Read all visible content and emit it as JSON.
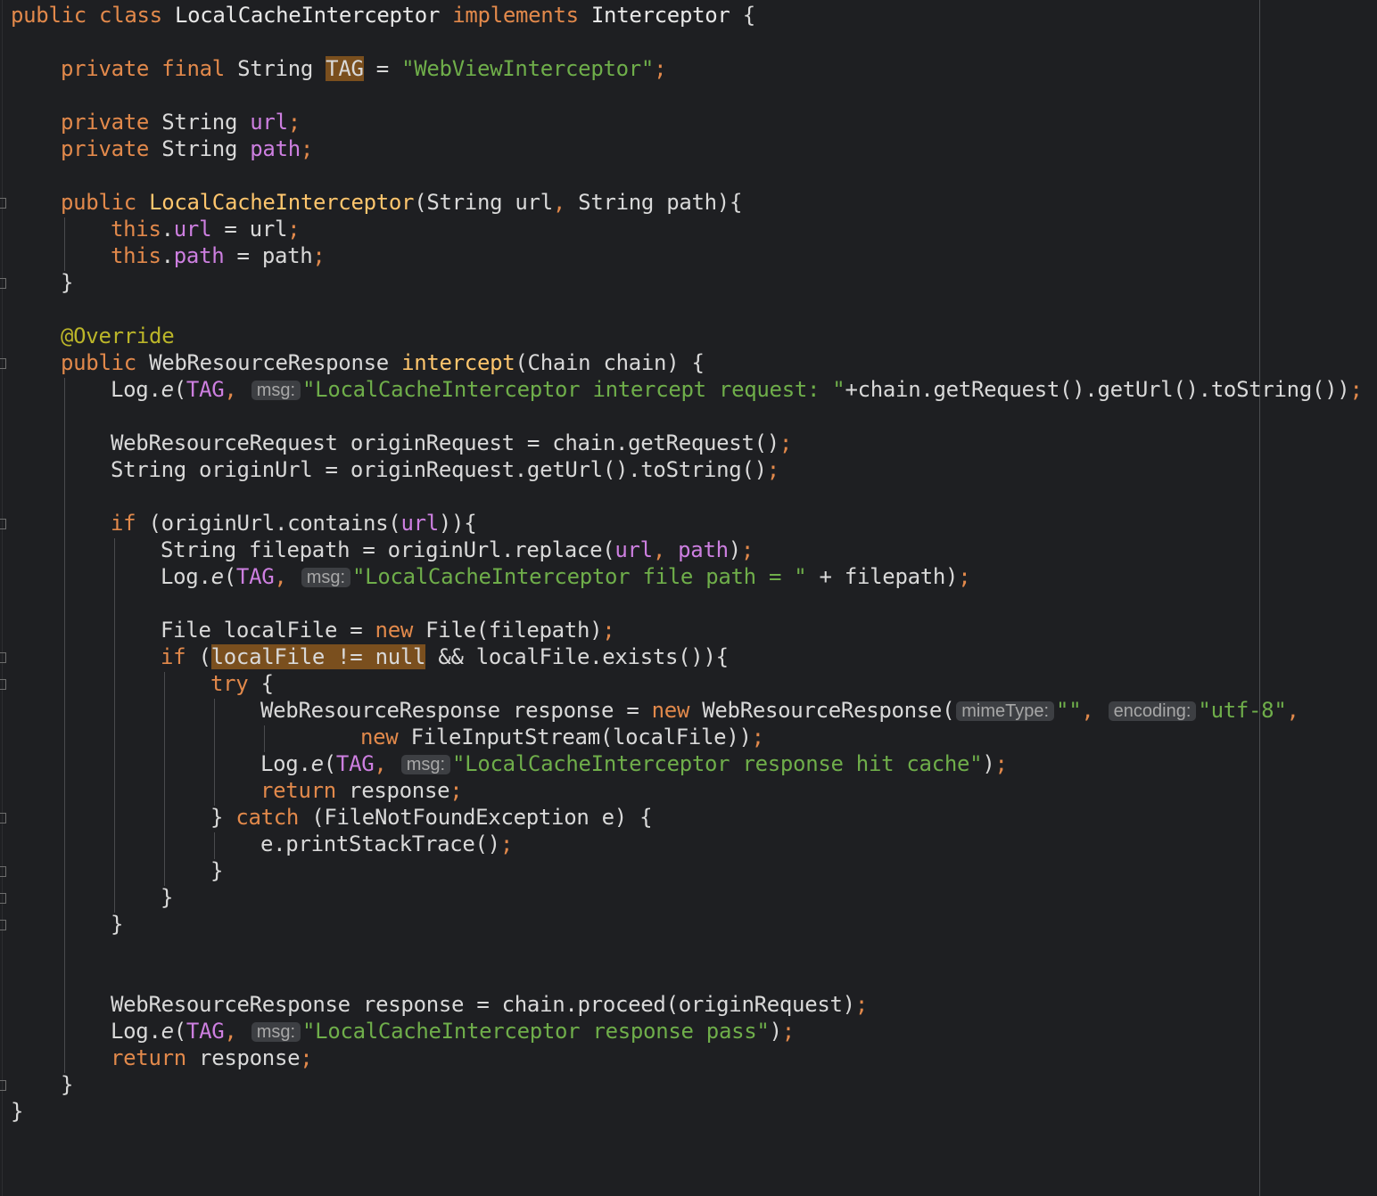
{
  "editor": {
    "class_decl": {
      "kw": "public class",
      "name": "LocalCacheInterceptor",
      "impl": "implements",
      "iface": "Interceptor",
      "brace": "{"
    },
    "tag_field": {
      "mods": "private final",
      "type": "String",
      "name": "TAG",
      "eq": "=",
      "value": "\"WebViewInterceptor\"",
      "semi": ";"
    },
    "url_field": {
      "mod": "private",
      "type": "String",
      "name": "url",
      "semi": ";"
    },
    "path_field": {
      "mod": "private",
      "type": "String",
      "name": "path",
      "semi": ";"
    },
    "constructor": {
      "mod": "public",
      "name": "LocalCacheInterceptor",
      "params": "(String url",
      "comma": ",",
      "params2": " String path){"
    },
    "this_url": {
      "kw": "this",
      "dot": ".",
      "fld": "url",
      "rest": " = url",
      "semi": ";"
    },
    "this_path": {
      "kw": "this",
      "dot": ".",
      "fld": "path",
      "rest": " = path",
      "semi": ";"
    },
    "close_brace": "}",
    "annotation": "@Override",
    "intercept": {
      "mod": "public",
      "type": "WebResourceResponse",
      "name": "intercept",
      "params": "(Chain chain) {"
    },
    "log1": {
      "pre": "Log.",
      "fn": "e",
      "open": "(",
      "tag": "TAG",
      "comma": ",",
      "hint": "msg:",
      "str": "\"LocalCacheInterceptor intercept request: \"",
      "rest": "+chain.getRequest().getUrl().toString())",
      "semi": ";"
    },
    "origin_req": {
      "text": "WebResourceRequest originRequest = chain.getRequest()",
      "semi": ";"
    },
    "origin_url": {
      "text": "String originUrl = originRequest.getUrl().toString()",
      "semi": ";"
    },
    "if1": {
      "kw": "if",
      "pre": " (originUrl.contains(",
      "fld": "url",
      "post": ")){"
    },
    "filepath": {
      "pre": "String filepath = originUrl.replace(",
      "fld1": "url",
      "comma": ",",
      "fld2": "path",
      "post": ")",
      "semi": ";"
    },
    "log2": {
      "pre": "Log.",
      "fn": "e",
      "open": "(",
      "tag": "TAG",
      "comma": ",",
      "hint": "msg:",
      "str": "\"LocalCacheInterceptor file path = \"",
      "rest": " + filepath)",
      "semi": ";"
    },
    "local_file": {
      "pre": "File localFile = ",
      "kw": "new",
      "post": " File(filepath)",
      "semi": ";"
    },
    "if2": {
      "kw": "if",
      "open": " (",
      "hl": "localFile != null",
      "post": " && localFile.exists()){"
    },
    "try": {
      "kw": "try",
      "brace": " {"
    },
    "resp1": {
      "pre": "WebResourceResponse response = ",
      "kw": "new",
      "post": " WebResourceResponse(",
      "hint1": "mimeType:",
      "str1": "\"\"",
      "comma": ",",
      "hint2": "encoding:",
      "str2": "\"utf-8\""
    },
    "resp1b": {
      "kw": "new",
      "post": " FileInputStream(localFile))",
      "semi": ";"
    },
    "log3": {
      "pre": "Log.",
      "fn": "e",
      "open": "(",
      "tag": "TAG",
      "comma": ",",
      "hint": "msg:",
      "str": "\"LocalCacheInterceptor response hit cache\"",
      "rest": ")",
      "semi": ";"
    },
    "return1": {
      "kw": "return",
      "post": " response",
      "semi": ";"
    },
    "catch": {
      "pre": "} ",
      "kw": "catch",
      "post": " (FileNotFoundException e) {"
    },
    "print_trace": {
      "text": "e.printStackTrace()",
      "semi": ";"
    },
    "proceed": {
      "text": "WebResourceResponse response = chain.proceed(originRequest)",
      "semi": ";"
    },
    "log4": {
      "pre": "Log.",
      "fn": "e",
      "open": "(",
      "tag": "TAG",
      "comma": ",",
      "hint": "msg:",
      "str": "\"LocalCacheInterceptor response pass\"",
      "rest": ")",
      "semi": ";"
    },
    "return2": {
      "kw": "return",
      "post": " response",
      "semi": ";"
    }
  },
  "colors": {
    "background": "#1e1f22",
    "keyword": "#e2894b",
    "string": "#6fae4a",
    "field": "#cd7fe0",
    "method": "#ffc66d",
    "annotation": "#bbb529",
    "highlight": "#7a4f1e"
  }
}
